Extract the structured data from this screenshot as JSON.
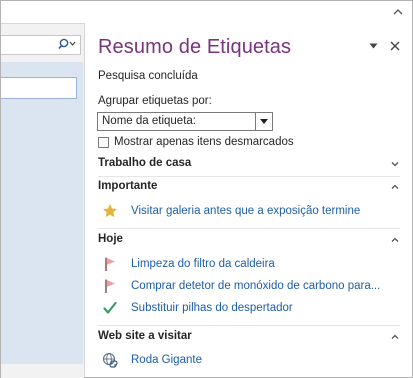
{
  "pane": {
    "title": "Resumo de Etiquetas",
    "status": "Pesquisa concluída",
    "group_label": "Agrupar etiquetas por:",
    "group_by_value": "Nome da etiqueta:",
    "checkbox_label": "Mostrar apenas itens desmarcados"
  },
  "sections": [
    {
      "title": "Trabalho de casa",
      "expanded": false,
      "items": []
    },
    {
      "title": "Importante",
      "expanded": true,
      "items": [
        {
          "icon": "star-icon",
          "label": "Visitar galeria antes que a exposição termine"
        }
      ]
    },
    {
      "title": "Hoje",
      "expanded": true,
      "items": [
        {
          "icon": "flag-icon",
          "label": "Limpeza do filtro da caldeira"
        },
        {
          "icon": "flag-icon",
          "label": "Comprar detetor de monóxido de carbono para..."
        },
        {
          "icon": "checkmark-icon",
          "label": "Substituir pilhas do despertador"
        }
      ]
    },
    {
      "title": "Web site a visitar",
      "expanded": true,
      "items": [
        {
          "icon": "web-link-icon",
          "label": "Roda Gigante"
        }
      ]
    }
  ],
  "colors": {
    "title": "#7a337e",
    "link": "#1e5ea6",
    "star": "#e8b33b",
    "flag": "#d98a8a",
    "checkmark": "#3a9b6a",
    "left_pane_blue": "#dbe5f1"
  }
}
